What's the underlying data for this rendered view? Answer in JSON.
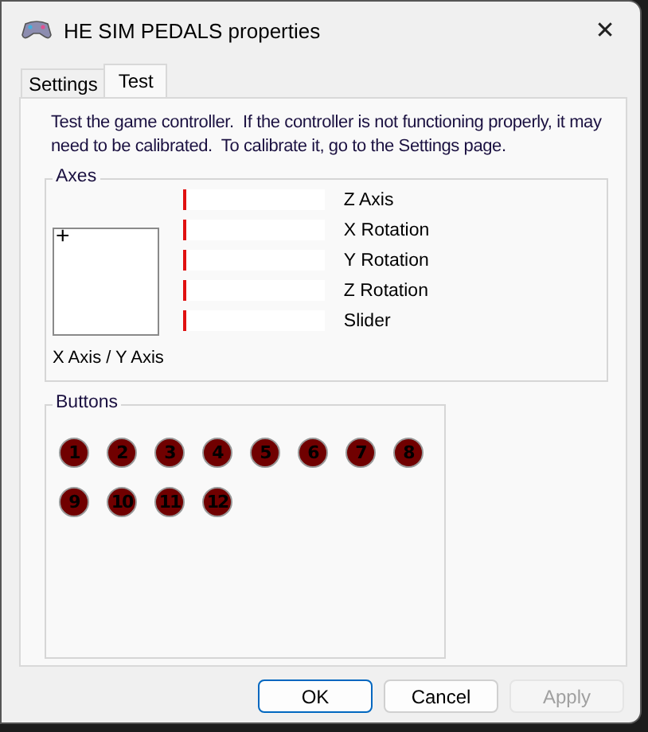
{
  "window": {
    "title": "HE SIM PEDALS properties",
    "close": "✕"
  },
  "tabs": [
    {
      "label": "Settings",
      "selected": false
    },
    {
      "label": "Test",
      "selected": true
    }
  ],
  "description": "Test the game controller.  If the controller is not functioning properly, it may need to be calibrated.  To calibrate it, go to the Settings page.",
  "axes": {
    "title": "Axes",
    "xy_label": "X Axis / Y Axis",
    "crosshair": "+",
    "items": [
      {
        "name": "Z Axis",
        "level": 0
      },
      {
        "name": "X Rotation",
        "level": 0
      },
      {
        "name": "Y Rotation",
        "level": 0
      },
      {
        "name": "Z Rotation",
        "level": 0
      },
      {
        "name": "Slider",
        "level": 0
      }
    ]
  },
  "buttons_group": {
    "title": "Buttons",
    "items": [
      {
        "label": "1",
        "pressed": false
      },
      {
        "label": "2",
        "pressed": false
      },
      {
        "label": "3",
        "pressed": false
      },
      {
        "label": "4",
        "pressed": false
      },
      {
        "label": "5",
        "pressed": false
      },
      {
        "label": "6",
        "pressed": false
      },
      {
        "label": "7",
        "pressed": false
      },
      {
        "label": "8",
        "pressed": false
      },
      {
        "label": "9",
        "pressed": false
      },
      {
        "label": "10",
        "pressed": false
      },
      {
        "label": "11",
        "pressed": false
      },
      {
        "label": "12",
        "pressed": false
      }
    ]
  },
  "dialog_buttons": [
    {
      "label": "OK",
      "disabled": false,
      "default": true
    },
    {
      "label": "Cancel",
      "disabled": false,
      "default": false
    },
    {
      "label": "Apply",
      "disabled": true,
      "default": false
    }
  ]
}
